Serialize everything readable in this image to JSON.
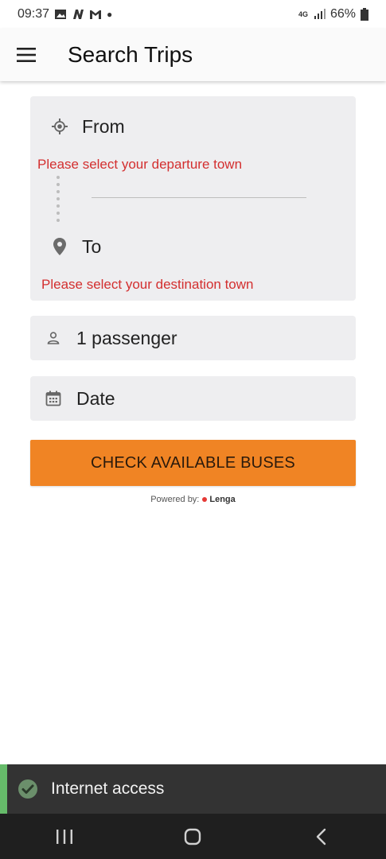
{
  "status_bar": {
    "time": "09:37",
    "network": "4G",
    "battery": "66%"
  },
  "app_bar": {
    "title": "Search Trips",
    "menu_icon": "menu-icon"
  },
  "route": {
    "from_label": "From",
    "from_error": "Please select your departure town",
    "to_label": "To",
    "to_error": "Please select your destination town"
  },
  "passengers": {
    "label": "1 passenger"
  },
  "date": {
    "label": "Date"
  },
  "cta": {
    "label": "CHECK AVAILABLE BUSES"
  },
  "powered": {
    "prefix": "Powered by:",
    "brand": "Lenga"
  },
  "snackbar": {
    "text": "Internet access"
  },
  "colors": {
    "accent": "#f08424",
    "error": "#d32f2f",
    "success": "#66bb6a"
  }
}
